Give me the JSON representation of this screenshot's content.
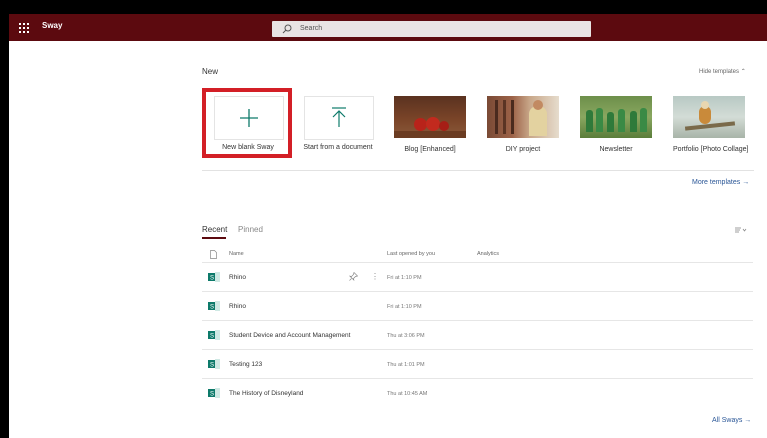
{
  "app": {
    "name": "Sway"
  },
  "search": {
    "placeholder": "Search"
  },
  "new_section": {
    "title": "New",
    "hide_templates": "Hide templates",
    "more_templates": "More templates",
    "tiles": [
      {
        "label": "New blank Sway"
      },
      {
        "label": "Start from a document"
      },
      {
        "label": "Blog [Enhanced]"
      },
      {
        "label": "DIY project"
      },
      {
        "label": "Newsletter"
      },
      {
        "label": "Portfolio [Photo Collage]"
      }
    ]
  },
  "recent_section": {
    "tabs": [
      {
        "label": "Recent"
      },
      {
        "label": "Pinned"
      }
    ],
    "columns": {
      "name": "Name",
      "last_opened": "Last opened by you",
      "analytics": "Analytics"
    },
    "rows": [
      {
        "name": "Rhino",
        "date": "Fri at 1:10 PM"
      },
      {
        "name": "Rhino",
        "date": "Fri at 1:10 PM"
      },
      {
        "name": "Student Device and Account Management",
        "date": "Thu at 3:06 PM"
      },
      {
        "name": "Testing 123",
        "date": "Thu at 1:01 PM"
      },
      {
        "name": "The History of Disneyland",
        "date": "Thu at 10:45 AM"
      }
    ],
    "all_sways": "All Sways"
  },
  "colors": {
    "topbar": "#5c0a0f",
    "highlight": "#d31f26",
    "link": "#2b5797",
    "tile_accent": "#0d7a6a"
  }
}
